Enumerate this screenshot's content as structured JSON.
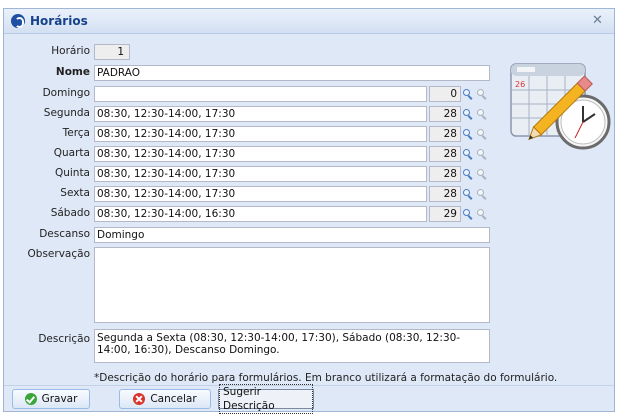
{
  "window": {
    "title": "Horários",
    "close_glyph": "✕"
  },
  "form": {
    "horario": {
      "label": "Horário",
      "value": "1"
    },
    "nome": {
      "label": "Nome",
      "value": "PADRAO"
    },
    "days": [
      {
        "label": "Domingo",
        "value": "",
        "count": "0"
      },
      {
        "label": "Segunda",
        "value": "08:30, 12:30-14:00, 17:30",
        "count": "28"
      },
      {
        "label": "Terça",
        "value": "08:30, 12:30-14:00, 17:30",
        "count": "28"
      },
      {
        "label": "Quarta",
        "value": "08:30, 12:30-14:00, 17:30",
        "count": "28"
      },
      {
        "label": "Quinta",
        "value": "08:30, 12:30-14:00, 17:30",
        "count": "28"
      },
      {
        "label": "Sexta",
        "value": "08:30, 12:30-14:00, 17:30",
        "count": "28"
      },
      {
        "label": "Sábado",
        "value": "08:30, 12:30-14:00, 16:30",
        "count": "29"
      }
    ],
    "descanso": {
      "label": "Descanso",
      "value": "Domingo"
    },
    "observacao": {
      "label": "Observação",
      "value": ""
    },
    "descricao": {
      "label": "Descrição",
      "value": "Segunda a Sexta (08:30, 12:30-14:00, 17:30), Sábado (08:30, 12:30-14:00, 16:30), Descanso Domingo."
    },
    "note": "*Descrição do horário para formulários. Em branco utilizará a formatação do formulário."
  },
  "buttons": {
    "save": "Gravar",
    "cancel": "Cancelar",
    "suggest": "Sugerir Descrição"
  },
  "icons": {
    "title": "app-logo-icon",
    "zoom": "magnifier-icon",
    "zoom_disabled": "magnifier-grey-icon",
    "art": "calendar-clock-pencil-icon",
    "save": "check-circle-icon",
    "cancel": "cancel-circle-icon"
  },
  "colors": {
    "title_text": "#15428b",
    "panel_bg": "#dfe8f6",
    "field_border": "#b5b8c8"
  }
}
